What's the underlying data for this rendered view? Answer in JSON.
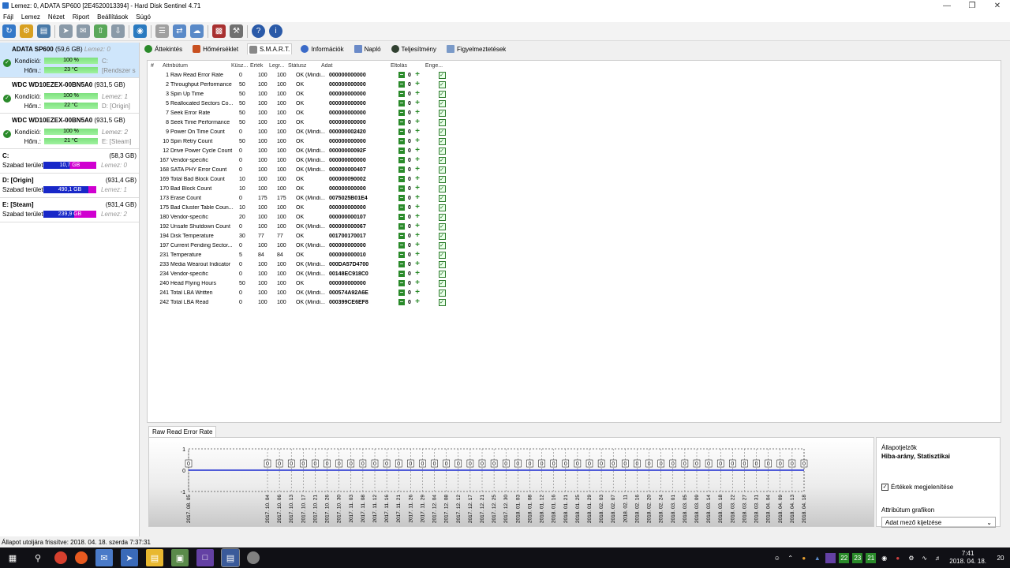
{
  "window": {
    "title": "Lemez: 0, ADATA SP600 [2E4520013394]  -  Hard Disk Sentinel 4.71"
  },
  "menu": [
    "Fájl",
    "Lemez",
    "Nézet",
    "Riport",
    "Beállítások",
    "Súgó"
  ],
  "disks": [
    {
      "name": "ADATA SP600",
      "size": "(59,6 GB)",
      "lemez": "Lemez: 0",
      "cond_label": "Kondíció:",
      "cond": "100 %",
      "cond_ext": "C:",
      "temp_label": "Hőm.:",
      "temp": "23 °C",
      "temp_ext": "[Rendszer szá"
    },
    {
      "name": "WDC WD10EZEX-00BN5A0",
      "size": "(931,5 GB)",
      "lemez": "",
      "cond_label": "Kondíció:",
      "cond": "100 %",
      "cond_ext": "Lemez: 1",
      "temp_label": "Hőm.:",
      "temp": "22 °C",
      "temp_ext": "D: [Origin]"
    },
    {
      "name": "WDC WD10EZEX-00BN5A0",
      "size": "(931,5 GB)",
      "lemez": "",
      "cond_label": "Kondíció:",
      "cond": "100 %",
      "cond_ext": "Lemez: 2",
      "temp_label": "Hőm.:",
      "temp": "21 °C",
      "temp_ext": "E: [Steam]"
    }
  ],
  "volumes": [
    {
      "name": "C:",
      "size": "(58,3 GB)",
      "free_label": "Szabad terület",
      "free": "10,7 GB",
      "lemez": "Lemez: 0",
      "free_frac": 0.18
    },
    {
      "name": "D: [Origin]",
      "size": "(931,4 GB)",
      "free_label": "Szabad terület",
      "free": "490,1 GB",
      "lemez": "Lemez: 1",
      "free_frac": 0.53
    },
    {
      "name": "E: [Steam]",
      "size": "(931,4 GB)",
      "free_label": "Szabad terület",
      "free": "239,9 GB",
      "lemez": "Lemez: 2",
      "free_frac": 0.26
    }
  ],
  "tabs": [
    "Áttekintés",
    "Hőmérséklet",
    "S.M.A.R.T.",
    "Információk",
    "Napló",
    "Teljesítmény",
    "Figyelmeztetések"
  ],
  "smart": {
    "headers": [
      "#",
      "Attribútum",
      "Küsz...",
      "Érték",
      "Legr...",
      "Státusz",
      "Adat",
      "Eltolás",
      "Enge..."
    ],
    "rows": [
      {
        "ok": false,
        "id": "1",
        "attr": "Raw Read Error Rate",
        "thr": "0",
        "val": "100",
        "worst": "100",
        "status": "OK (Mindi...",
        "data": "000000000000"
      },
      {
        "ok": true,
        "id": "2",
        "attr": "Throughput Performance",
        "thr": "50",
        "val": "100",
        "worst": "100",
        "status": "OK",
        "data": "000000000000"
      },
      {
        "ok": true,
        "id": "3",
        "attr": "Spin Up Time",
        "thr": "50",
        "val": "100",
        "worst": "100",
        "status": "OK",
        "data": "000000000000"
      },
      {
        "ok": true,
        "id": "5",
        "attr": "Reallocated Sectors Co...",
        "thr": "50",
        "val": "100",
        "worst": "100",
        "status": "OK",
        "data": "000000000000"
      },
      {
        "ok": true,
        "id": "7",
        "attr": "Seek Error Rate",
        "thr": "50",
        "val": "100",
        "worst": "100",
        "status": "OK",
        "data": "000000000000"
      },
      {
        "ok": true,
        "id": "8",
        "attr": "Seek Time Performance",
        "thr": "50",
        "val": "100",
        "worst": "100",
        "status": "OK",
        "data": "000000000000"
      },
      {
        "ok": false,
        "id": "9",
        "attr": "Power On Time Count",
        "thr": "0",
        "val": "100",
        "worst": "100",
        "status": "OK (Mindi...",
        "data": "000000002420"
      },
      {
        "ok": true,
        "id": "10",
        "attr": "Spin Retry Count",
        "thr": "50",
        "val": "100",
        "worst": "100",
        "status": "OK",
        "data": "000000000000"
      },
      {
        "ok": false,
        "id": "12",
        "attr": "Drive Power Cycle Count",
        "thr": "0",
        "val": "100",
        "worst": "100",
        "status": "OK (Mindi...",
        "data": "00000000092F"
      },
      {
        "ok": false,
        "id": "167",
        "attr": "Vendor-specific",
        "thr": "0",
        "val": "100",
        "worst": "100",
        "status": "OK (Mindi...",
        "data": "000000000000"
      },
      {
        "ok": false,
        "id": "168",
        "attr": "SATA PHY Error Count",
        "thr": "0",
        "val": "100",
        "worst": "100",
        "status": "OK (Mindi...",
        "data": "000000000407"
      },
      {
        "ok": true,
        "id": "169",
        "attr": "Total Bad Block Count",
        "thr": "10",
        "val": "100",
        "worst": "100",
        "status": "OK",
        "data": "000000090002"
      },
      {
        "ok": true,
        "id": "170",
        "attr": "Bad Block Count",
        "thr": "10",
        "val": "100",
        "worst": "100",
        "status": "OK",
        "data": "000000000000"
      },
      {
        "ok": false,
        "id": "173",
        "attr": "Erase Count",
        "thr": "0",
        "val": "175",
        "worst": "175",
        "status": "OK (Mindi...",
        "data": "0075025B01E4"
      },
      {
        "ok": true,
        "id": "175",
        "attr": "Bad Cluster Table Coun...",
        "thr": "10",
        "val": "100",
        "worst": "100",
        "status": "OK",
        "data": "000000000000"
      },
      {
        "ok": true,
        "id": "180",
        "attr": "Vendor-specific",
        "thr": "20",
        "val": "100",
        "worst": "100",
        "status": "OK",
        "data": "000000000107"
      },
      {
        "ok": false,
        "id": "192",
        "attr": "Unsafe Shutdown Count",
        "thr": "0",
        "val": "100",
        "worst": "100",
        "status": "OK (Mindi...",
        "data": "000000000067"
      },
      {
        "ok": false,
        "id": "194",
        "attr": "Disk Temperature",
        "thr": "30",
        "val": "77",
        "worst": "77",
        "status": "OK",
        "data": "001700170017"
      },
      {
        "ok": false,
        "id": "197",
        "attr": "Current Pending Sector...",
        "thr": "0",
        "val": "100",
        "worst": "100",
        "status": "OK (Mindi...",
        "data": "000000000000"
      },
      {
        "ok": true,
        "id": "231",
        "attr": "Temperature",
        "thr": "5",
        "val": "84",
        "worst": "84",
        "status": "OK",
        "data": "000000000010"
      },
      {
        "ok": false,
        "id": "233",
        "attr": "Media Wearout Indicator",
        "thr": "0",
        "val": "100",
        "worst": "100",
        "status": "OK (Mindi...",
        "data": "000DA57D4700"
      },
      {
        "ok": false,
        "id": "234",
        "attr": "Vendor-specific",
        "thr": "0",
        "val": "100",
        "worst": "100",
        "status": "OK (Mindi...",
        "data": "00148EC918C0"
      },
      {
        "ok": true,
        "id": "240",
        "attr": "Head Flying Hours",
        "thr": "50",
        "val": "100",
        "worst": "100",
        "status": "OK",
        "data": "000000000000"
      },
      {
        "ok": false,
        "id": "241",
        "attr": "Total LBA Written",
        "thr": "0",
        "val": "100",
        "worst": "100",
        "status": "OK (Mindi...",
        "data": "000574A92A6E"
      },
      {
        "ok": false,
        "id": "242",
        "attr": "Total LBA Read",
        "thr": "0",
        "val": "100",
        "worst": "100",
        "status": "OK (Mindi...",
        "data": "000399CE6EF8"
      }
    ],
    "offset_value": "0"
  },
  "graph_tab": "Raw Read Error Rate",
  "chart_data": {
    "type": "line",
    "title": "",
    "xlabel": "",
    "ylabel": "",
    "ylim": [
      -1,
      1
    ],
    "y_ticks": [
      "1",
      "0",
      "-1"
    ],
    "categories": [
      "2017. 08. 05",
      "2017. 10. 04",
      "2017. 10. 06",
      "2017. 10. 13",
      "2017. 10. 17",
      "2017. 10. 21",
      "2017. 10. 26",
      "2017. 10. 30",
      "2017. 11. 03",
      "2017. 11. 08",
      "2017. 11. 12",
      "2017. 11. 16",
      "2017. 11. 21",
      "2017. 11. 26",
      "2017. 11. 29",
      "2017. 12. 04",
      "2017. 12. 08",
      "2017. 12. 12",
      "2017. 12. 17",
      "2017. 12. 21",
      "2017. 12. 25",
      "2017. 12. 30",
      "2018. 01. 03",
      "2018. 01. 08",
      "2018. 01. 12",
      "2018. 01. 16",
      "2018. 01. 21",
      "2018. 01. 25",
      "2018. 01. 29",
      "2018. 02. 03",
      "2018. 02. 07",
      "2018. 02. 11",
      "2018. 02. 16",
      "2018. 02. 20",
      "2018. 02. 24",
      "2018. 03. 01",
      "2018. 03. 05",
      "2018. 03. 09",
      "2018. 03. 14",
      "2018. 03. 18",
      "2018. 03. 22",
      "2018. 03. 27",
      "2018. 03. 31",
      "2018. 04. 04",
      "2018. 04. 09",
      "2018. 04. 13",
      "2018. 04. 18"
    ],
    "values": [
      0,
      0,
      0,
      0,
      0,
      0,
      0,
      0,
      0,
      0,
      0,
      0,
      0,
      0,
      0,
      0,
      0,
      0,
      0,
      0,
      0,
      0,
      0,
      0,
      0,
      0,
      0,
      0,
      0,
      0,
      0,
      0,
      0,
      0,
      0,
      0,
      0,
      0,
      0,
      0,
      0,
      0,
      0,
      0,
      0,
      0,
      0
    ],
    "point_labels": [
      "0",
      "0",
      "0",
      "0",
      "0",
      "0",
      "0",
      "0",
      "0",
      "0",
      "0",
      "0",
      "0",
      "0",
      "0",
      "0",
      "0",
      "0",
      "0",
      "0",
      "0",
      "0",
      "0",
      "0",
      "0",
      "0",
      "0",
      "0",
      "0",
      "0",
      "0",
      "0",
      "0",
      "0",
      "0",
      "0",
      "0",
      "0",
      "0",
      "0",
      "0",
      "0",
      "0",
      "0",
      "0",
      "0",
      "0"
    ],
    "grid": true,
    "line_color": "#1a2ad0"
  },
  "side": {
    "label1": "Állapotjelzők",
    "label2": "Hiba-arány, Statisztikai",
    "show_values": "Értékek megjelenítése",
    "attr_graph": "Attribútum grafikon",
    "select_value": "Adat mező kijelzése"
  },
  "status": "Állapot utoljára frissítve: 2018. 04. 18. szerda 7:37:31",
  "clock": {
    "time": "7:41",
    "date": "2018. 04. 18."
  },
  "tray_temps": [
    "22",
    "23",
    "21"
  ],
  "notif_count": "20"
}
